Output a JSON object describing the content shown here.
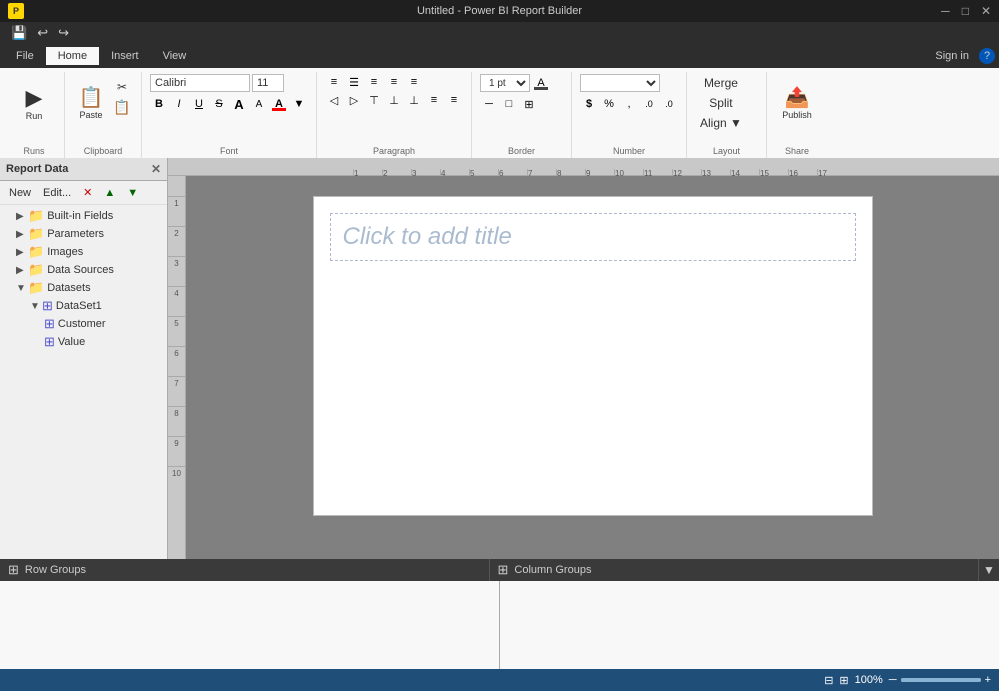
{
  "titleBar": {
    "appTitle": "Untitled - Power BI Report Builder",
    "minBtn": "─",
    "maxBtn": "□",
    "closeBtn": "✕"
  },
  "quickAccess": {
    "saveIcon": "💾",
    "undoIcon": "↩",
    "redoIcon": "↪"
  },
  "ribbonTabs": {
    "file": "File",
    "home": "Home",
    "insert": "Insert",
    "view": "View",
    "signIn": "Sign in",
    "help": "?"
  },
  "ribbon": {
    "groups": {
      "runs": {
        "label": "Runs",
        "runBtn": "Run"
      },
      "clipboard": {
        "label": "Clipboard",
        "pasteBtn": "Paste",
        "cutBtn": "✂",
        "copyBtn": "📋"
      },
      "font": {
        "label": "Font",
        "fontName": "Calibri",
        "fontSize": "11",
        "boldBtn": "B",
        "italicBtn": "I",
        "underlineBtn": "U",
        "strikeBtn": "S",
        "growBtn": "A",
        "shrinkBtn": "A",
        "colorBtn": "A",
        "highlightBtn": "▼"
      },
      "paragraph": {
        "label": "Paragraph",
        "alignLeftBtn": "≡",
        "alignCenterBtn": "≡",
        "alignRightBtn": "≡",
        "bulletBtn": "≡",
        "numberBtn": "≡",
        "indentLeftBtn": "≡",
        "indentRightBtn": "≡",
        "valignTopBtn": "⊤",
        "valignMidBtn": "⊥",
        "valignBotBtn": "⊥",
        "lineSpacingBtn": "≡",
        "columnBtn": "≡"
      },
      "border": {
        "label": "Border",
        "weightSelect": "1 pt",
        "colorBtn": "A",
        "styleBtn": "─",
        "borderBtn": "□",
        "paintBtn": "⊞"
      },
      "number": {
        "label": "Number",
        "formatSelect": "",
        "dollarBtn": "$",
        "percentBtn": "%",
        "commaBtn": ",",
        "increaseBtn": ".0",
        "decreaseBtn": ".0"
      },
      "layout": {
        "label": "Layout",
        "mergeBtn": "Merge",
        "splitBtn": "Split",
        "alignBtn": "Align ▼"
      },
      "share": {
        "label": "Share",
        "publishBtn": "Publish"
      }
    }
  },
  "leftPanel": {
    "title": "Report Data",
    "toolbar": {
      "newBtn": "New",
      "editBtn": "Edit...",
      "deleteBtn": "✕",
      "upBtn": "▲",
      "downBtn": "▼"
    },
    "tree": [
      {
        "id": "builtin-fields",
        "label": "Built-in Fields",
        "type": "folder",
        "indent": 0,
        "expanded": false
      },
      {
        "id": "parameters",
        "label": "Parameters",
        "type": "folder",
        "indent": 0,
        "expanded": false
      },
      {
        "id": "images",
        "label": "Images",
        "type": "folder",
        "indent": 0,
        "expanded": false
      },
      {
        "id": "data-sources",
        "label": "Data Sources",
        "type": "folder",
        "indent": 0,
        "expanded": false
      },
      {
        "id": "datasets",
        "label": "Datasets",
        "type": "folder",
        "indent": 0,
        "expanded": true
      },
      {
        "id": "dataset1",
        "label": "DataSet1",
        "type": "table",
        "indent": 1,
        "expanded": true
      },
      {
        "id": "customer",
        "label": "Customer",
        "type": "field",
        "indent": 2,
        "expanded": false
      },
      {
        "id": "value",
        "label": "Value",
        "type": "field",
        "indent": 2,
        "expanded": false
      }
    ]
  },
  "canvas": {
    "titlePlaceholder": "Click to add title",
    "rulerMarks": [
      "1",
      "2",
      "3",
      "4",
      "5",
      "6",
      "7",
      "8",
      "9",
      "10",
      "11",
      "12",
      "13",
      "14",
      "15",
      "16",
      "17"
    ],
    "rulerLeftMarks": [
      "1",
      "2",
      "3",
      "4",
      "5",
      "6",
      "7",
      "8",
      "9",
      "10"
    ]
  },
  "bottomPanels": {
    "rowGroups": "Row Groups",
    "columnGroups": "Column Groups",
    "rowIcon": "⊞",
    "colIcon": "⊞",
    "arrowBtn": "▼"
  },
  "statusBar": {
    "leftIcon": "⊟",
    "rightIcon": "⊞",
    "zoomLevel": "100%",
    "minusBtn": "─",
    "plusBtn": "+"
  }
}
